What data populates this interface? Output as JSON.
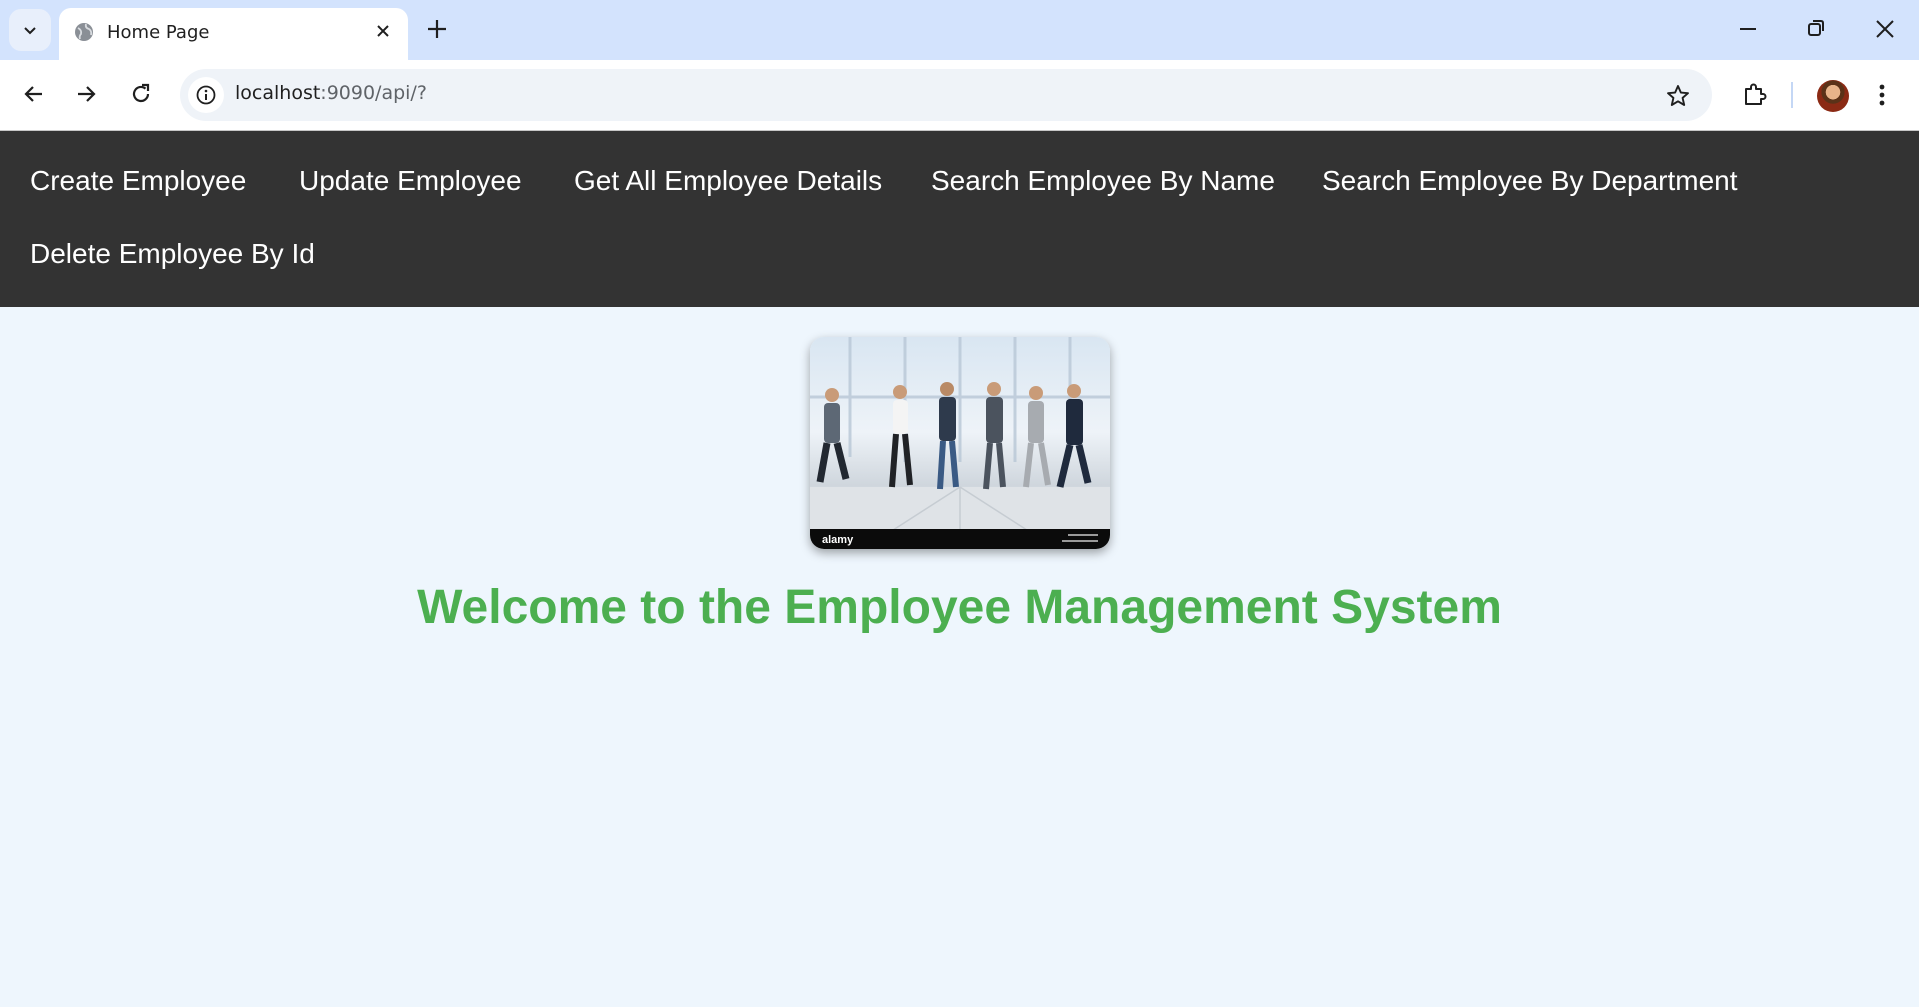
{
  "browser": {
    "tab_title": "Home Page",
    "url_host": "localhost",
    "url_rest": ":9090/api/?"
  },
  "nav": {
    "items": [
      {
        "label": "Create Employee"
      },
      {
        "label": "Update Employee"
      },
      {
        "label": "Get All Employee Details"
      },
      {
        "label": "Search Employee By Name"
      },
      {
        "label": "Search Employee By Department"
      },
      {
        "label": "Delete Employee By Id"
      }
    ]
  },
  "hero": {
    "watermark": "alamy"
  },
  "welcome_heading": "Welcome to the Employee Management System",
  "colors": {
    "nav_bg": "#333333",
    "page_bg": "#eef6fd",
    "heading": "#4caf50"
  }
}
